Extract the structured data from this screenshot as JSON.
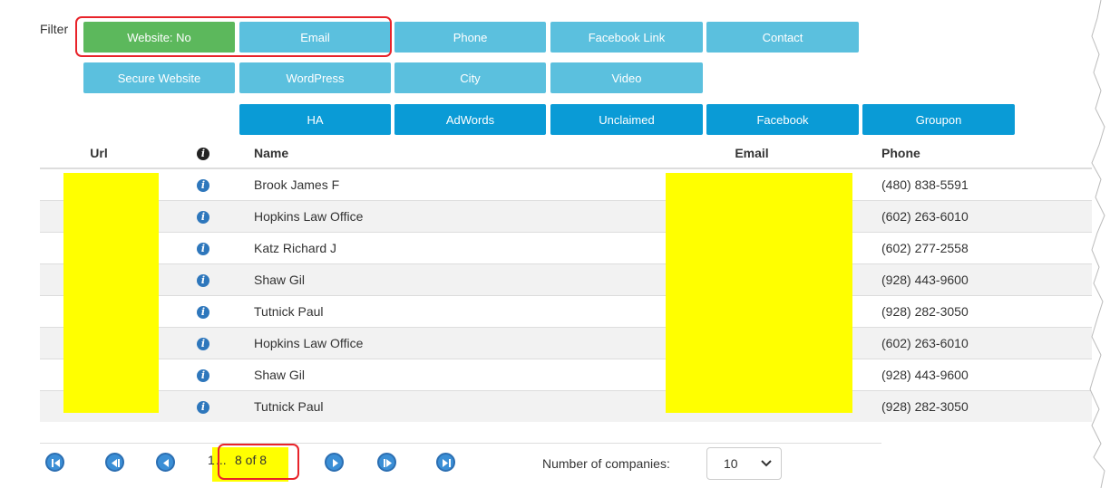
{
  "filter": {
    "label": "Filter",
    "row1": [
      "Website: No",
      "Email",
      "Phone",
      "Facebook Link",
      "Contact"
    ],
    "row2": [
      "Secure Website",
      "WordPress",
      "City",
      "Video"
    ],
    "row3": [
      "HA",
      "AdWords",
      "Unclaimed",
      "Facebook",
      "Groupon"
    ]
  },
  "table": {
    "headers": {
      "url": "Url",
      "name": "Name",
      "email": "Email",
      "phone": "Phone"
    },
    "rows": [
      {
        "name": "Brook James F",
        "phone": "(480) 838-5591"
      },
      {
        "name": "Hopkins Law Office",
        "phone": "(602) 263-6010"
      },
      {
        "name": "Katz Richard J",
        "phone": "(602) 277-2558"
      },
      {
        "name": "Shaw Gil",
        "phone": "(928) 443-9600"
      },
      {
        "name": "Tutnick Paul",
        "phone": "(928) 282-3050"
      },
      {
        "name": "Hopkins Law Office",
        "phone": "(602) 263-6010"
      },
      {
        "name": "Shaw Gil",
        "phone": "(928) 443-9600"
      },
      {
        "name": "Tutnick Paul",
        "phone": "(928) 282-3050"
      }
    ]
  },
  "pager": {
    "first": "1",
    "ellipsis": "...",
    "current": "8 of 8",
    "count_label": "Number of companies:",
    "count_value": "10"
  },
  "colors": {
    "green": "#5cb85c",
    "light_blue": "#5bc0de",
    "dark_blue": "#0a9bd6",
    "highlight": "#ffff00",
    "annotation_red": "#e8232a"
  }
}
